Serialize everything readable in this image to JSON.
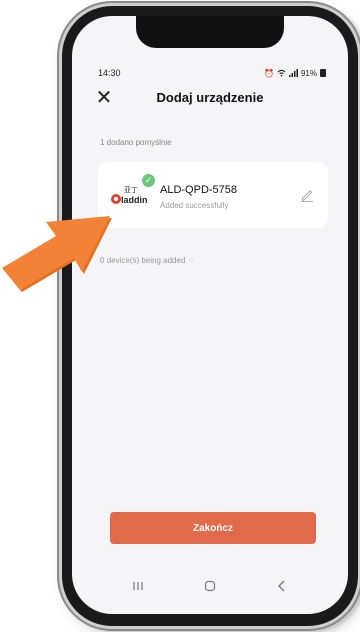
{
  "status_bar": {
    "time": "14:30",
    "battery": "91%"
  },
  "header": {
    "title": "Dodaj urządzenie",
    "close_icon": "close-icon"
  },
  "success_count": "1 dodano pomyślnie",
  "device": {
    "name": "ALD-QPD-5758",
    "status": "Added successfully",
    "logo_text": "laddin",
    "logo_chinese": "亚丁",
    "badge_icon": "check-icon",
    "edit_icon": "pencil-icon"
  },
  "adding_status": "0 device(s) being added",
  "finish_button_label": "Zakończ",
  "colors": {
    "accent": "#e06a4a",
    "success": "#6cc67d",
    "arrow": "#ee7a2a"
  }
}
